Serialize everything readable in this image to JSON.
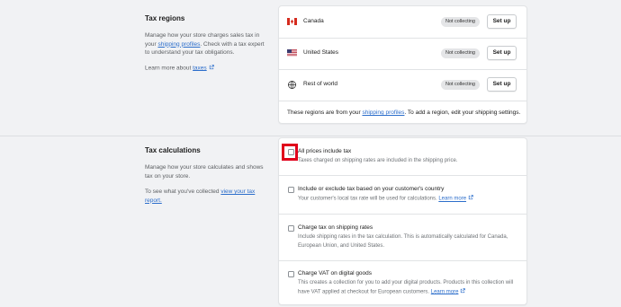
{
  "tax_regions": {
    "title": "Tax regions",
    "description_before": "Manage how your store charges sales tax in your ",
    "description_link": "shipping profiles",
    "description_after": ". Check with a tax expert to understand your tax obligations.",
    "learn_more_prefix": "Learn more about ",
    "learn_more_link": "taxes",
    "regions": [
      {
        "name": "Canada",
        "status": "Not collecting",
        "action": "Set up"
      },
      {
        "name": "United States",
        "status": "Not collecting",
        "action": "Set up"
      },
      {
        "name": "Rest of world",
        "status": "Not collecting",
        "action": "Set up"
      }
    ],
    "footer_before": "These regions are from your ",
    "footer_link": "shipping profiles",
    "footer_after": ". To add a region, edit your shipping settings."
  },
  "tax_calculations": {
    "title": "Tax calculations",
    "description": "Manage how your store calculates and shows tax on your store.",
    "collected_prefix": "To see what you've collected ",
    "collected_link": "view your tax report.",
    "options": [
      {
        "label": "All prices include tax",
        "help": "Taxes charged on shipping rates are included in the shipping price.",
        "help_link": "",
        "checked": false
      },
      {
        "label": "Include or exclude tax based on your customer's country",
        "help": "Your customer's local tax rate will be used for calculations. ",
        "help_link": "Learn more",
        "checked": false
      },
      {
        "label": "Charge tax on shipping rates",
        "help": "Include shipping rates in the tax calculation. This is automatically calculated for Canada, European Union, and United States.",
        "help_link": "",
        "checked": false
      },
      {
        "label": "Charge VAT on digital goods",
        "help": "This creates a collection for you to add your digital products. Products in this collection will have VAT applied at checkout for European customers. ",
        "help_link": "Learn more",
        "checked": false
      }
    ]
  },
  "colors": {
    "link": "#2c6ecb",
    "highlight": "#e0001b",
    "badge_bg": "#e4e5e7",
    "page_bg": "#f1f2f4"
  },
  "icons": {
    "canada": "canada-flag-icon",
    "united_states": "us-flag-icon",
    "rest_of_world": "globe-icon",
    "external": "external-link-icon"
  }
}
